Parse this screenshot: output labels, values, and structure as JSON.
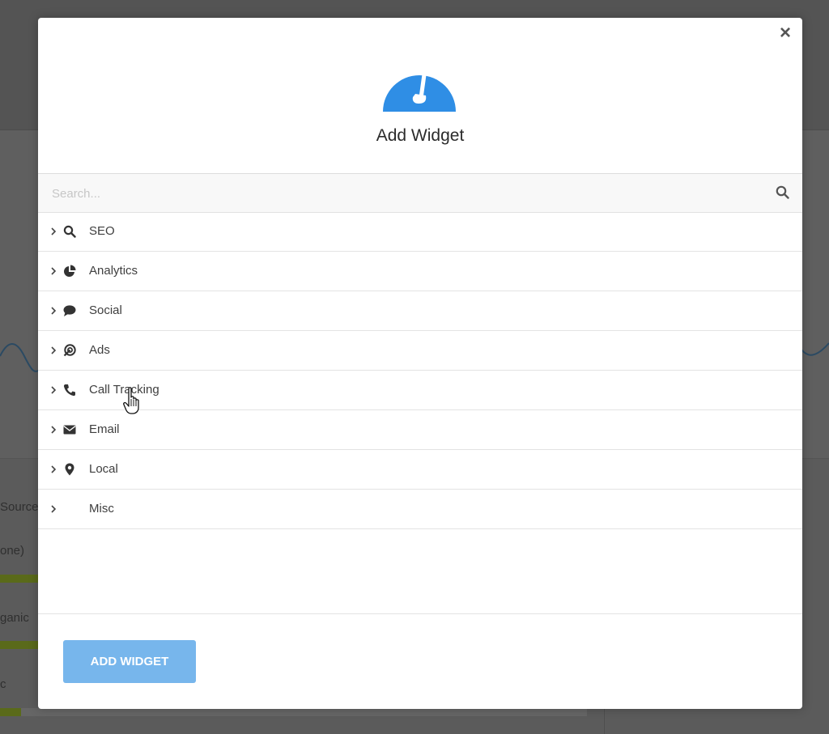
{
  "background": {
    "left_labels": [
      "Sources",
      "one)",
      "ganic",
      "c"
    ]
  },
  "modal": {
    "title": "Add Widget",
    "close_label": "×",
    "header_icon": "brush-icon",
    "search": {
      "placeholder": "Search...",
      "value": ""
    },
    "categories": [
      {
        "label": "SEO",
        "icon": "search-icon"
      },
      {
        "label": "Analytics",
        "icon": "pie-chart-icon"
      },
      {
        "label": "Social",
        "icon": "comment-icon"
      },
      {
        "label": "Ads",
        "icon": "ads-target-icon"
      },
      {
        "label": "Call Tracking",
        "icon": "phone-icon"
      },
      {
        "label": "Email",
        "icon": "envelope-icon"
      },
      {
        "label": "Local",
        "icon": "map-marker-icon"
      },
      {
        "label": "Misc",
        "icon": ""
      }
    ],
    "add_button_label": "ADD WIDGET",
    "colors": {
      "accent": "#2f8ee5",
      "button": "#77b6ec"
    }
  }
}
